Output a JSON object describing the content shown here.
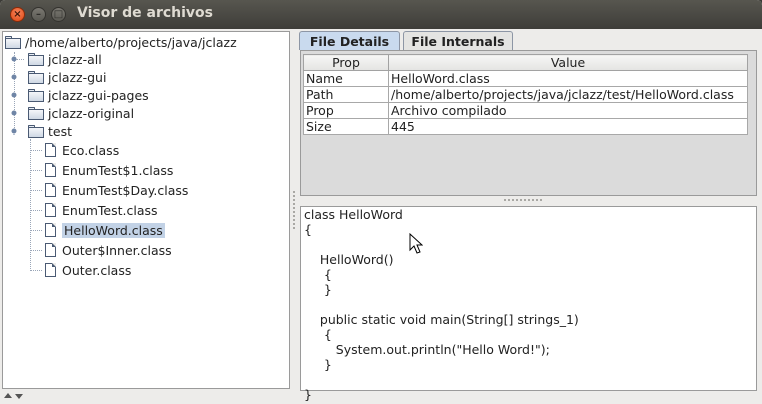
{
  "window": {
    "title": "Visor de archivos"
  },
  "tree": {
    "root": "/home/alberto/projects/java/jclazz",
    "folders": [
      "jclazz-all",
      "jclazz-gui",
      "jclazz-gui-pages",
      "jclazz-original",
      "test"
    ],
    "files": [
      "Eco.class",
      "EnumTest$1.class",
      "EnumTest$Day.class",
      "EnumTest.class",
      "HelloWord.class",
      "Outer$Inner.class",
      "Outer.class"
    ],
    "selected": "HelloWord.class"
  },
  "tabs": [
    "File Details",
    "File Internals"
  ],
  "details": {
    "headers": [
      "Prop",
      "Value"
    ],
    "rows": [
      [
        "Name",
        "HelloWord.class"
      ],
      [
        "Path",
        "/home/alberto/projects/java/jclazz/test/HelloWord.class"
      ],
      [
        "Prop",
        "Archivo compilado"
      ],
      [
        "Size",
        "445"
      ]
    ]
  },
  "code": [
    "class HelloWord",
    "{",
    "",
    "    HelloWord()",
    "     {",
    "     }",
    "",
    "    public static void main(String[] strings_1)",
    "     {",
    "        System.out.println(\"Hello Word!\");",
    "     }",
    "",
    "}"
  ],
  "colors": {
    "selection": "#c2d2e6",
    "active_tab": "#c9daee",
    "close_button": "#dd4814"
  },
  "icons": {
    "folder": "folder-icon",
    "file": "file-icon"
  }
}
